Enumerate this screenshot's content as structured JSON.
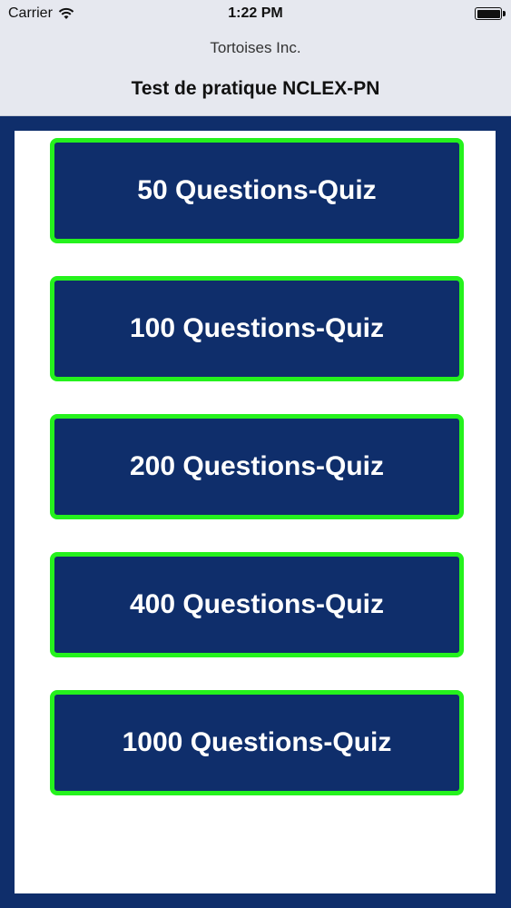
{
  "status_bar": {
    "carrier": "Carrier",
    "time": "1:22 PM"
  },
  "nav": {
    "company": "Tortoises Inc.",
    "title": "Test de pratique NCLEX-PN"
  },
  "quiz_buttons": [
    {
      "label": "50 Questions-Quiz"
    },
    {
      "label": "100 Questions-Quiz"
    },
    {
      "label": "200 Questions-Quiz"
    },
    {
      "label": "400 Questions-Quiz"
    },
    {
      "label": "1000 Questions-Quiz"
    }
  ],
  "colors": {
    "navy": "#0f2e6b",
    "button_border": "#25f21d",
    "bar_bg": "#e6e8ef"
  }
}
